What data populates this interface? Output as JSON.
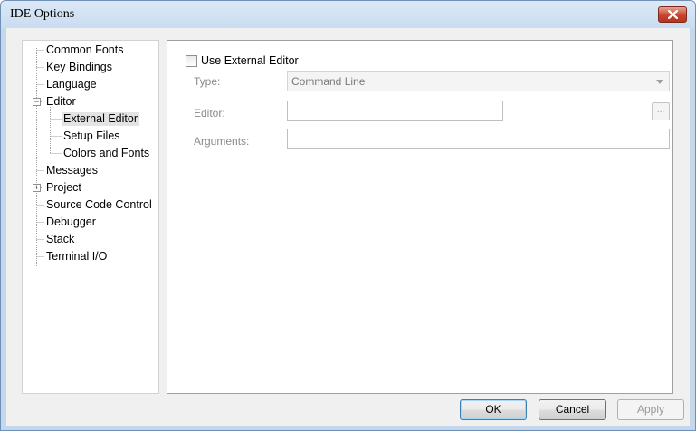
{
  "window": {
    "title": "IDE Options"
  },
  "tree": {
    "items": [
      {
        "label": "Common Fonts"
      },
      {
        "label": "Key Bindings"
      },
      {
        "label": "Language"
      },
      {
        "label": "Editor",
        "expander": "−"
      },
      {
        "label": "External Editor",
        "selected": true
      },
      {
        "label": "Setup Files"
      },
      {
        "label": "Colors and Fonts"
      },
      {
        "label": "Messages"
      },
      {
        "label": "Project",
        "expander": "+"
      },
      {
        "label": "Source Code Control"
      },
      {
        "label": "Debugger"
      },
      {
        "label": "Stack"
      },
      {
        "label": "Terminal I/O"
      }
    ]
  },
  "editor_settings": {
    "use_external_label": "Use External Editor",
    "use_external_checked": false,
    "type_label": "Type:",
    "type_value": "Command Line",
    "editor_label": "Editor:",
    "editor_value": "",
    "browse_label": "...",
    "arguments_label": "Arguments:",
    "arguments_value": ""
  },
  "buttons": {
    "ok": "OK",
    "cancel": "Cancel",
    "apply": "Apply"
  }
}
